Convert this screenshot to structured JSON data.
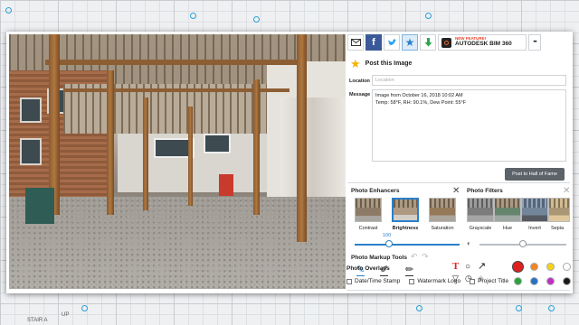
{
  "background": {
    "label_stair": "STAIR A",
    "label_up": "UP"
  },
  "toolbar": {
    "email_icon": "envelope-icon",
    "facebook_icon": "facebook-icon",
    "twitter_icon": "twitter-icon",
    "favorite_icon": "star-icon",
    "download_icon": "download-arrow-icon",
    "bim_badge": "NEW FEATURE!",
    "bim_label": "AUTODESK BIM 360",
    "more_label": "•••"
  },
  "post": {
    "title": "Post this Image",
    "location_label": "Location",
    "location_placeholder": "Location",
    "message_label": "Message",
    "message_line1": "Image from October 16, 2018 10:02 AM",
    "message_line2": "Temp: 58°F, RH: 90.1%, Dew Point: 55°F",
    "post_button": "Post to Hall of Fame"
  },
  "enhancers": {
    "title": "Photo Enhancers",
    "items": [
      {
        "label": "Contrast",
        "selected": false
      },
      {
        "label": "Brightness",
        "selected": true
      },
      {
        "label": "Saturation",
        "selected": false
      }
    ],
    "slider_value": "100",
    "slider_fraction": 0.33
  },
  "filters": {
    "title": "Photo Filters",
    "items": [
      "Grayscale",
      "Hue",
      "Invert",
      "Sepia"
    ],
    "slider_fraction": 0.5
  },
  "markup": {
    "title": "Photo Markup Tools",
    "tools": [
      "pen-icon",
      "brush-icon",
      "highlighter-icon"
    ],
    "shape_tools": [
      "text-tool-icon",
      "circle-tool-icon",
      "arrow-tool-icon",
      "polygon-tool-icon",
      "clock-tool-icon",
      "tag-tool-icon"
    ],
    "colors": [
      "#e02020",
      "#f5851f",
      "#f4d21c",
      "#ffffff",
      "#29a33b",
      "#2671c6",
      "#c02fc4",
      "#1a1a1a"
    ]
  },
  "overlays": {
    "title": "Photo Overlays",
    "options": [
      "Date/Time Stamp",
      "Watermark Logo",
      "Project Title"
    ]
  }
}
